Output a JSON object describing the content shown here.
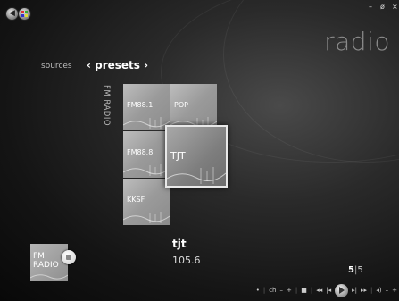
{
  "window": {
    "title": "radio",
    "minimize_glyph": "–",
    "restore_glyph": "ø",
    "close_glyph": "×"
  },
  "nav": {
    "back_icon": "back-arrow-icon",
    "home_icon": "windows-logo-icon",
    "back_glyph": "◀"
  },
  "breadcrumb": {
    "sources_label": "sources",
    "presets_label": "‹ presets ›"
  },
  "group": {
    "label": "FM RADIO"
  },
  "presets": [
    {
      "label": "FM88.1"
    },
    {
      "label": "POP"
    },
    {
      "label": "FM88.8"
    },
    {
      "label": "TJT"
    },
    {
      "label": "KKSF"
    }
  ],
  "now_playing": {
    "name": "tjt",
    "frequency": "105.6"
  },
  "mini_tile": {
    "label_line1": "FM",
    "label_line2": "RADIO"
  },
  "pager": {
    "current": "5",
    "separator": "|",
    "total": "5"
  },
  "transport": {
    "dot": "•",
    "sep": "|",
    "channel_label": "ch",
    "ch_minus": "–",
    "ch_plus": "+",
    "stop": "■",
    "rewind": "◂◂",
    "prev": "|◂",
    "next": "▸|",
    "ffwd": "▸▸",
    "volume_icon": "◂)",
    "vol_minus": "–",
    "vol_plus": "+"
  }
}
